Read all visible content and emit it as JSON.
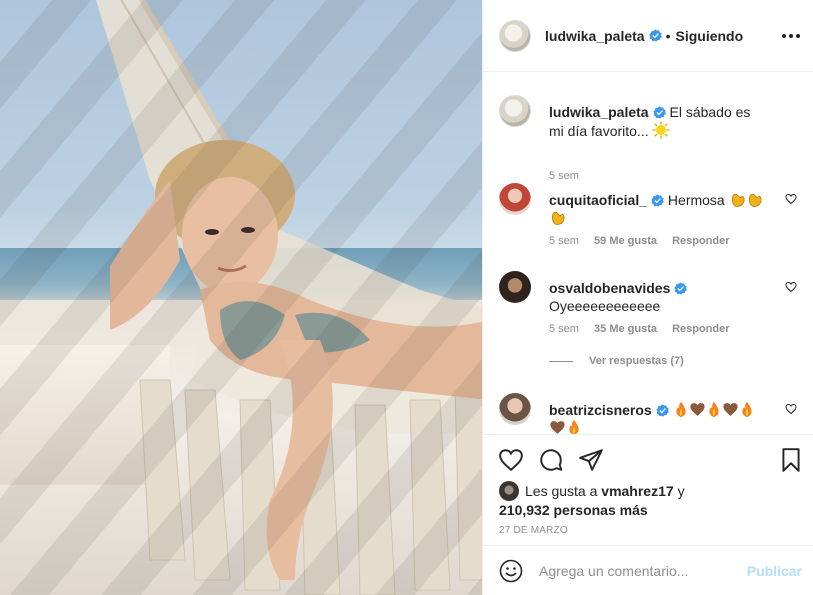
{
  "post": {
    "owner": "ludwika_paleta",
    "follow_status": "Siguiendo",
    "separator": "•",
    "caption_text": "El sábado es mi día favorito...",
    "caption_time": "5 sem"
  },
  "comments": [
    {
      "user": "cuquitaoficial_",
      "text": "Hermosa",
      "emojis": [
        "clapping-hands",
        "clapping-hands",
        "clapping-hands"
      ],
      "time": "5 sem",
      "likes": "59 Me gusta",
      "reply": "Responder"
    },
    {
      "user": "osvaldobenavides",
      "text": "Oyeeeeeeeeeeee",
      "time": "5 sem",
      "likes": "35 Me gusta",
      "reply": "Responder",
      "view_replies": "Ver respuestas (7)"
    },
    {
      "user": "beatrizcisneros",
      "text": "",
      "emojis": [
        "fire",
        "brown-heart",
        "fire",
        "brown-heart",
        "fire",
        "brown-heart",
        "fire"
      ]
    }
  ],
  "likes": {
    "prefix": "Les gusta a",
    "user": "vmahrez17",
    "connector": "y",
    "count": "210,932 personas más"
  },
  "date": "27 DE MARZO",
  "add_comment": {
    "placeholder": "Agrega un comentario...",
    "publish": "Publicar"
  },
  "colors": {
    "verified": "#3897f0",
    "publish_disabled": "#b2dffc",
    "meta_gray": "#8e8e8e",
    "text": "#262626"
  },
  "icons": [
    "more-options-icon",
    "heart-icon",
    "comment-icon",
    "share-icon",
    "save-icon",
    "emoji-icon",
    "verified-badge-icon",
    "sun-emoji-icon"
  ]
}
